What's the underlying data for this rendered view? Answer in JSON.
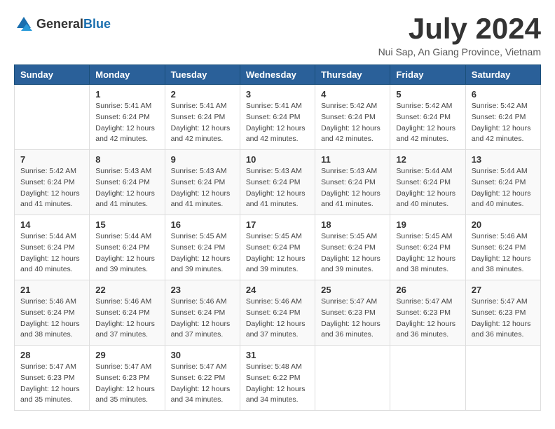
{
  "header": {
    "logo_general": "General",
    "logo_blue": "Blue",
    "month_title": "July 2024",
    "subtitle": "Nui Sap, An Giang Province, Vietnam"
  },
  "days_of_week": [
    "Sunday",
    "Monday",
    "Tuesday",
    "Wednesday",
    "Thursday",
    "Friday",
    "Saturday"
  ],
  "weeks": [
    [
      {
        "day": "",
        "info": ""
      },
      {
        "day": "1",
        "info": "Sunrise: 5:41 AM\nSunset: 6:24 PM\nDaylight: 12 hours\nand 42 minutes."
      },
      {
        "day": "2",
        "info": "Sunrise: 5:41 AM\nSunset: 6:24 PM\nDaylight: 12 hours\nand 42 minutes."
      },
      {
        "day": "3",
        "info": "Sunrise: 5:41 AM\nSunset: 6:24 PM\nDaylight: 12 hours\nand 42 minutes."
      },
      {
        "day": "4",
        "info": "Sunrise: 5:42 AM\nSunset: 6:24 PM\nDaylight: 12 hours\nand 42 minutes."
      },
      {
        "day": "5",
        "info": "Sunrise: 5:42 AM\nSunset: 6:24 PM\nDaylight: 12 hours\nand 42 minutes."
      },
      {
        "day": "6",
        "info": "Sunrise: 5:42 AM\nSunset: 6:24 PM\nDaylight: 12 hours\nand 42 minutes."
      }
    ],
    [
      {
        "day": "7",
        "info": "Sunrise: 5:42 AM\nSunset: 6:24 PM\nDaylight: 12 hours\nand 41 minutes."
      },
      {
        "day": "8",
        "info": "Sunrise: 5:43 AM\nSunset: 6:24 PM\nDaylight: 12 hours\nand 41 minutes."
      },
      {
        "day": "9",
        "info": "Sunrise: 5:43 AM\nSunset: 6:24 PM\nDaylight: 12 hours\nand 41 minutes."
      },
      {
        "day": "10",
        "info": "Sunrise: 5:43 AM\nSunset: 6:24 PM\nDaylight: 12 hours\nand 41 minutes."
      },
      {
        "day": "11",
        "info": "Sunrise: 5:43 AM\nSunset: 6:24 PM\nDaylight: 12 hours\nand 41 minutes."
      },
      {
        "day": "12",
        "info": "Sunrise: 5:44 AM\nSunset: 6:24 PM\nDaylight: 12 hours\nand 40 minutes."
      },
      {
        "day": "13",
        "info": "Sunrise: 5:44 AM\nSunset: 6:24 PM\nDaylight: 12 hours\nand 40 minutes."
      }
    ],
    [
      {
        "day": "14",
        "info": "Sunrise: 5:44 AM\nSunset: 6:24 PM\nDaylight: 12 hours\nand 40 minutes."
      },
      {
        "day": "15",
        "info": "Sunrise: 5:44 AM\nSunset: 6:24 PM\nDaylight: 12 hours\nand 39 minutes."
      },
      {
        "day": "16",
        "info": "Sunrise: 5:45 AM\nSunset: 6:24 PM\nDaylight: 12 hours\nand 39 minutes."
      },
      {
        "day": "17",
        "info": "Sunrise: 5:45 AM\nSunset: 6:24 PM\nDaylight: 12 hours\nand 39 minutes."
      },
      {
        "day": "18",
        "info": "Sunrise: 5:45 AM\nSunset: 6:24 PM\nDaylight: 12 hours\nand 39 minutes."
      },
      {
        "day": "19",
        "info": "Sunrise: 5:45 AM\nSunset: 6:24 PM\nDaylight: 12 hours\nand 38 minutes."
      },
      {
        "day": "20",
        "info": "Sunrise: 5:46 AM\nSunset: 6:24 PM\nDaylight: 12 hours\nand 38 minutes."
      }
    ],
    [
      {
        "day": "21",
        "info": "Sunrise: 5:46 AM\nSunset: 6:24 PM\nDaylight: 12 hours\nand 38 minutes."
      },
      {
        "day": "22",
        "info": "Sunrise: 5:46 AM\nSunset: 6:24 PM\nDaylight: 12 hours\nand 37 minutes."
      },
      {
        "day": "23",
        "info": "Sunrise: 5:46 AM\nSunset: 6:24 PM\nDaylight: 12 hours\nand 37 minutes."
      },
      {
        "day": "24",
        "info": "Sunrise: 5:46 AM\nSunset: 6:24 PM\nDaylight: 12 hours\nand 37 minutes."
      },
      {
        "day": "25",
        "info": "Sunrise: 5:47 AM\nSunset: 6:23 PM\nDaylight: 12 hours\nand 36 minutes."
      },
      {
        "day": "26",
        "info": "Sunrise: 5:47 AM\nSunset: 6:23 PM\nDaylight: 12 hours\nand 36 minutes."
      },
      {
        "day": "27",
        "info": "Sunrise: 5:47 AM\nSunset: 6:23 PM\nDaylight: 12 hours\nand 36 minutes."
      }
    ],
    [
      {
        "day": "28",
        "info": "Sunrise: 5:47 AM\nSunset: 6:23 PM\nDaylight: 12 hours\nand 35 minutes."
      },
      {
        "day": "29",
        "info": "Sunrise: 5:47 AM\nSunset: 6:23 PM\nDaylight: 12 hours\nand 35 minutes."
      },
      {
        "day": "30",
        "info": "Sunrise: 5:47 AM\nSunset: 6:22 PM\nDaylight: 12 hours\nand 34 minutes."
      },
      {
        "day": "31",
        "info": "Sunrise: 5:48 AM\nSunset: 6:22 PM\nDaylight: 12 hours\nand 34 minutes."
      },
      {
        "day": "",
        "info": ""
      },
      {
        "day": "",
        "info": ""
      },
      {
        "day": "",
        "info": ""
      }
    ]
  ]
}
